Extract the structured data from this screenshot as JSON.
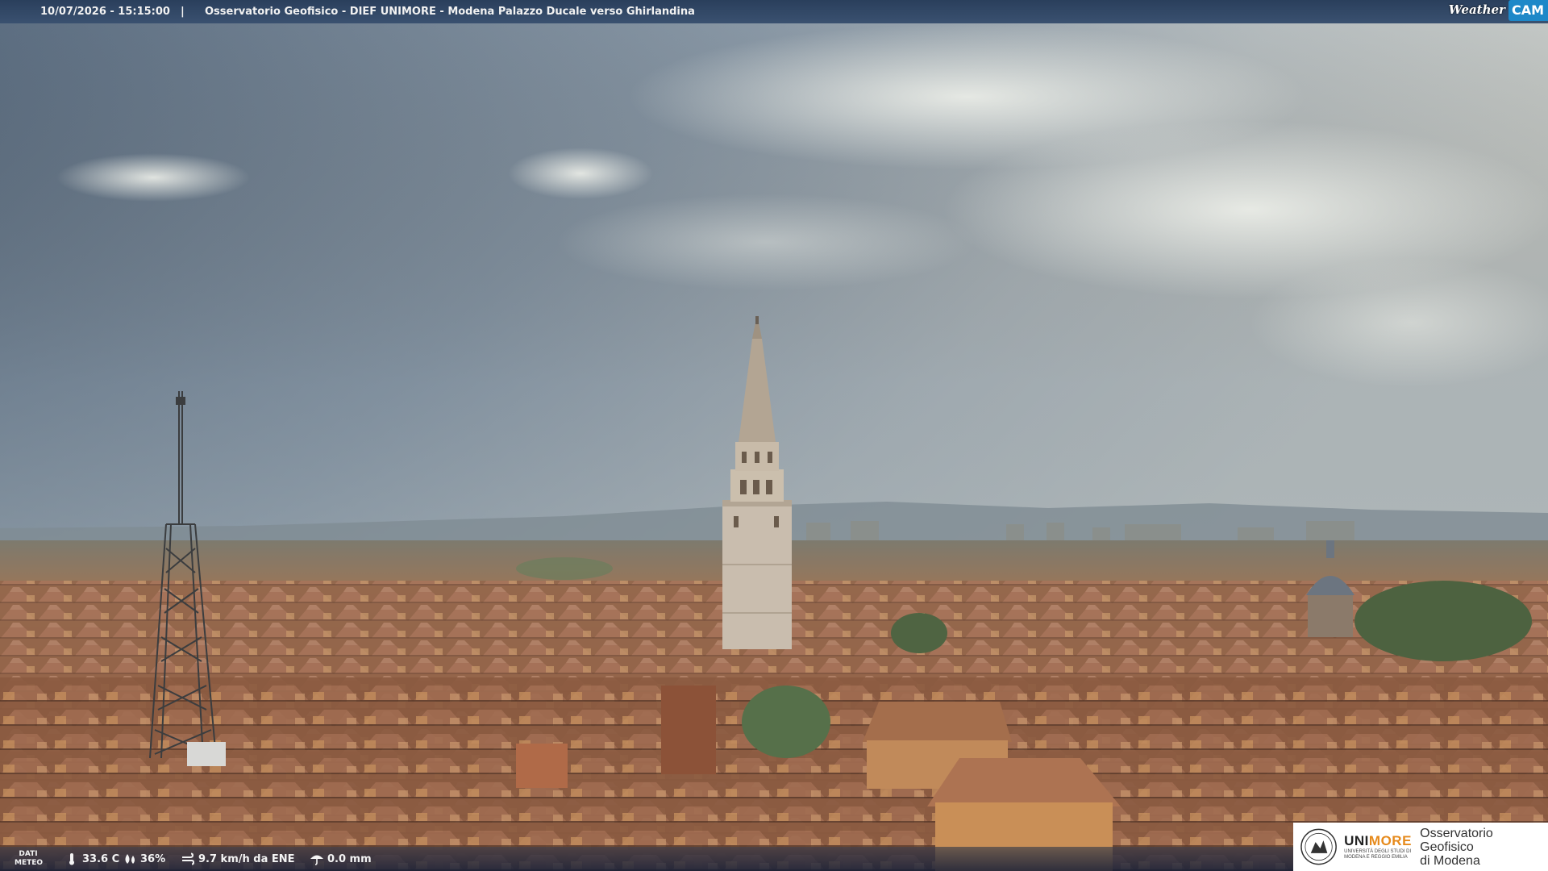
{
  "header": {
    "timestamp": "10/07/2026 - 15:15:00",
    "separator": "|",
    "title": "Osservatorio Geofisico - DIEF UNIMORE - Modena Palazzo Ducale verso Ghirlandina"
  },
  "brand": {
    "weather": "Weather",
    "cam": "CAM"
  },
  "weather_bar": {
    "label_line1": "DATI",
    "label_line2": "METEO",
    "temperature": "33.6 C",
    "humidity": "36%",
    "wind": "9.7 km/h da ENE",
    "rain": "0.0 mm"
  },
  "logo": {
    "uni_prefix": "UNI",
    "uni_suffix": "MORE",
    "uni_small": "UNIVERSITÀ DEGLI STUDI DI MODENA E REGGIO EMILIA",
    "observatory_line1": "Osservatorio Geofisico",
    "observatory_line2": "di Modena"
  },
  "colors": {
    "topbar": "#2a3f5c",
    "cam_badge": "#1e88c8",
    "unimore_accent": "#e68a1c"
  }
}
